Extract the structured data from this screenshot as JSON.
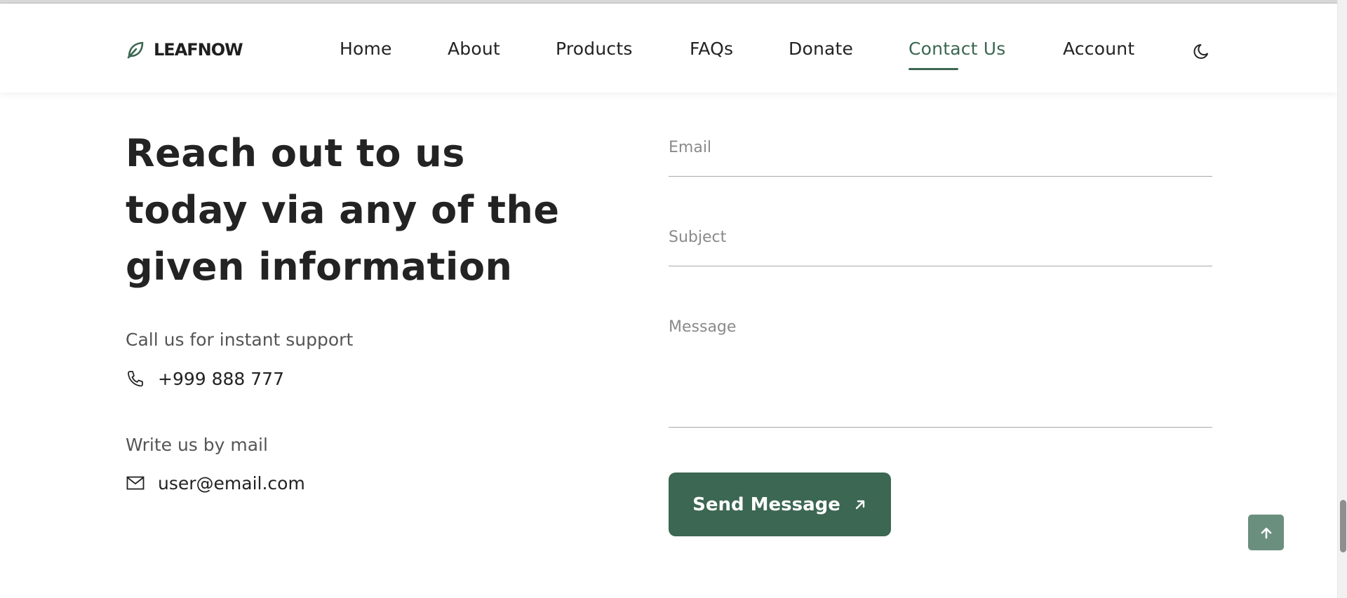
{
  "header": {
    "logo_text": "LEAFNOW",
    "nav": [
      {
        "label": "Home"
      },
      {
        "label": "About"
      },
      {
        "label": "Products"
      },
      {
        "label": "FAQs"
      },
      {
        "label": "Donate"
      },
      {
        "label": "Contact Us",
        "active": true
      },
      {
        "label": "Account"
      }
    ],
    "theme_toggle_icon": "moon-icon"
  },
  "main": {
    "headline": "Reach out to us today via any of the given information",
    "call_label": "Call us for instant support",
    "phone": "+999 888 777",
    "mail_label": "Write us by mail",
    "email": "user@email.com"
  },
  "form": {
    "email_placeholder": "Email",
    "subject_placeholder": "Subject",
    "message_placeholder": "Message",
    "send_label": "Send Message"
  },
  "colors": {
    "accent": "#3c6752",
    "scroll_top_bg": "#6b8f7e",
    "text": "#232323"
  }
}
